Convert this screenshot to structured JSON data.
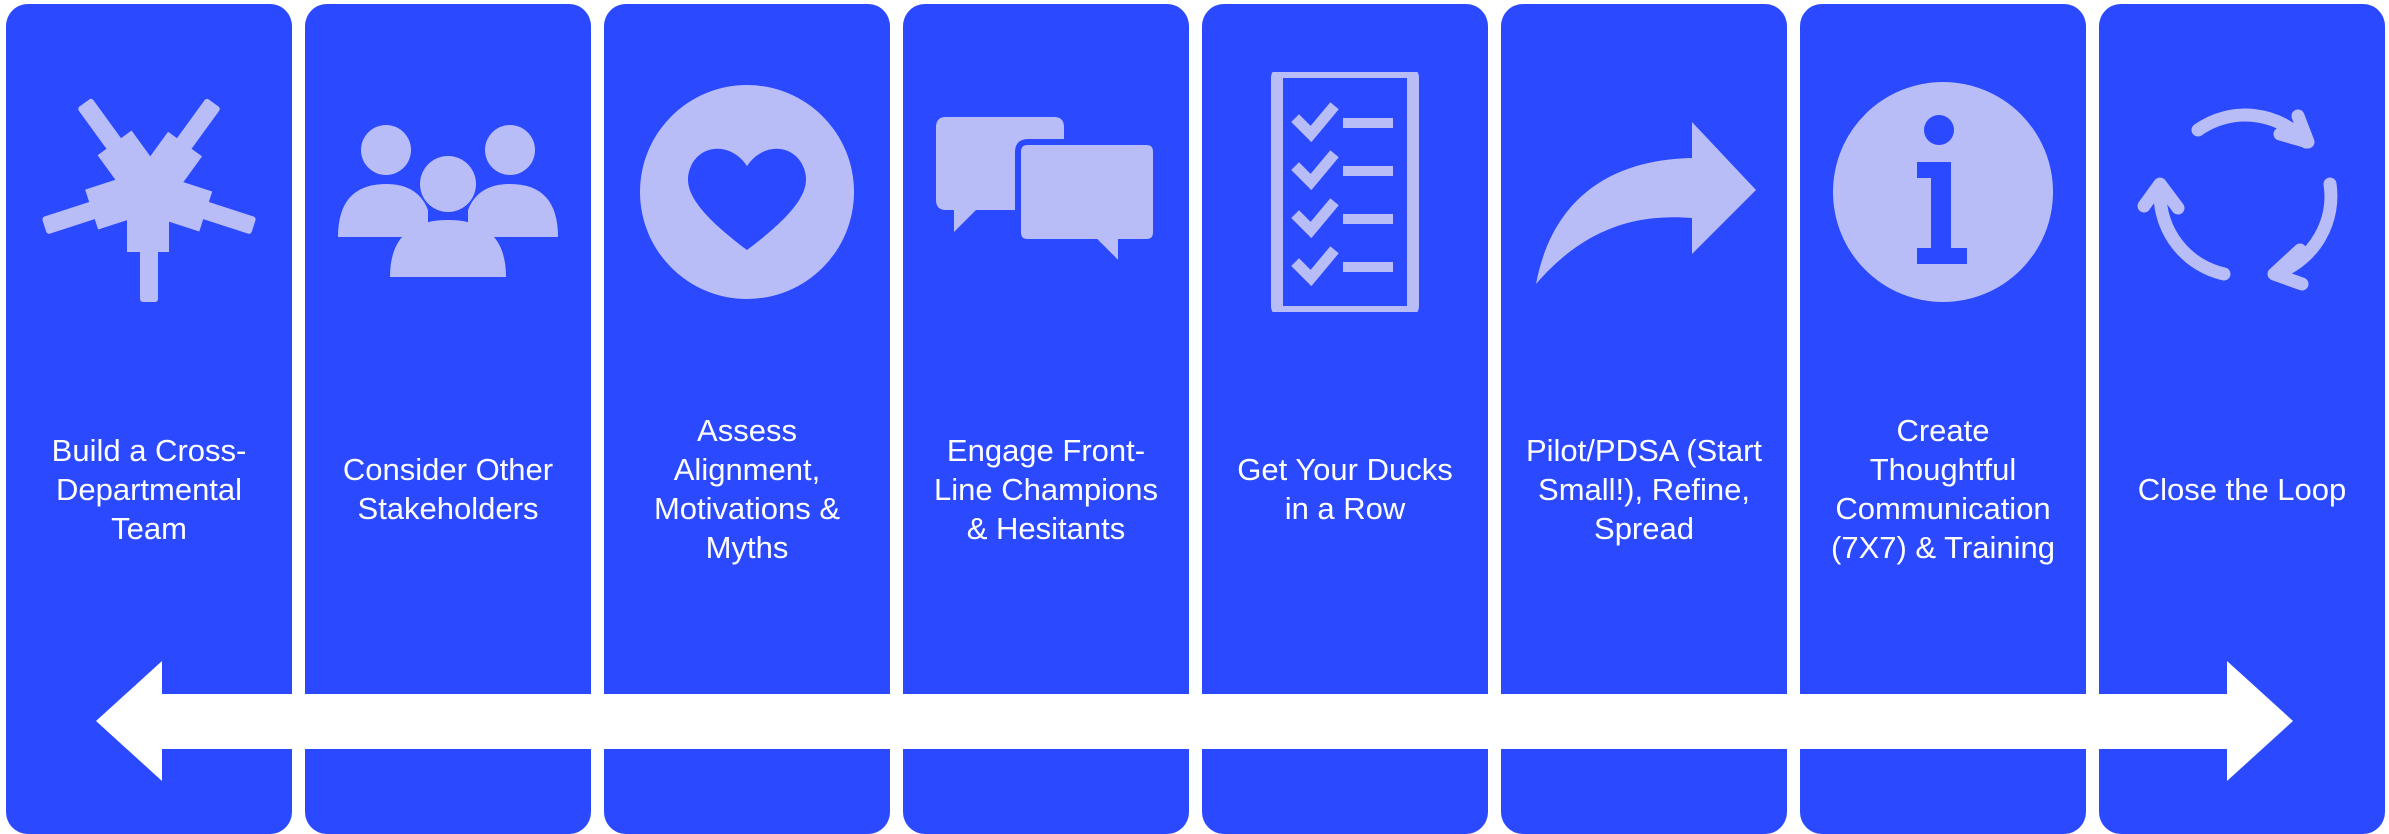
{
  "colors": {
    "panel": "#2b49ff",
    "icon": "#b8bdf8",
    "text": "#ffffff",
    "arrow": "#ffffff",
    "background": "#ffffff"
  },
  "steps": [
    {
      "label": "Build a Cross-\nDepartmental\nTeam",
      "icon": "hands-circle-icon"
    },
    {
      "label": "Consider Other\nStakeholders",
      "icon": "people-group-icon"
    },
    {
      "label": "Assess\nAlignment,\nMotivations &\nMyths",
      "icon": "heart-icon"
    },
    {
      "label": "Engage Front-\nLine Champions\n& Hesitants",
      "icon": "chat-bubbles-icon"
    },
    {
      "label": "Get Your Ducks\nin a Row",
      "icon": "checklist-icon"
    },
    {
      "label": "Pilot/PDSA (Start\nSmall!), Refine,\nSpread",
      "icon": "curved-arrow-icon"
    },
    {
      "label": "Create\nThoughtful\nCommunication\n(7X7) & Training",
      "icon": "info-icon"
    },
    {
      "label": "Close the Loop",
      "icon": "cycle-arrows-icon"
    }
  ]
}
